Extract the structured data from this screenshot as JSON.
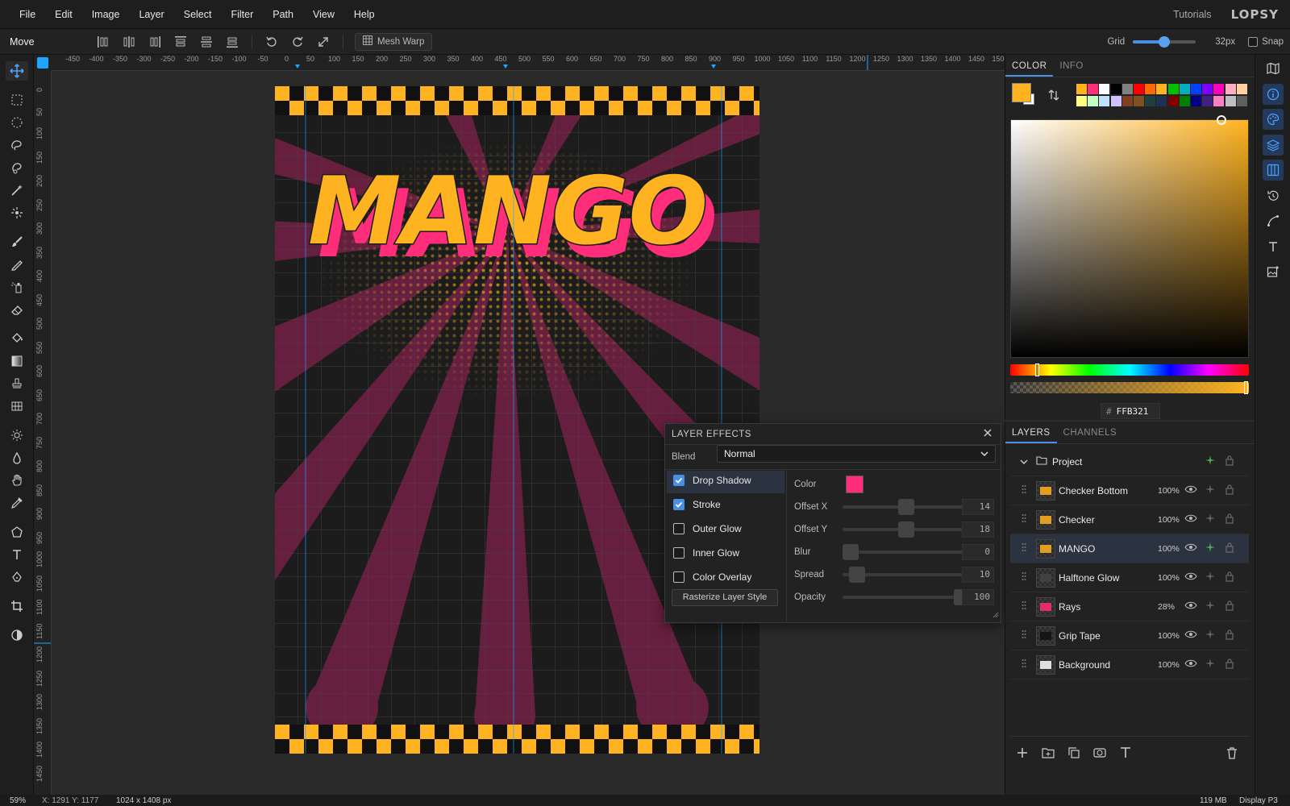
{
  "app": {
    "menu": [
      "File",
      "Edit",
      "Image",
      "Layer",
      "Select",
      "Filter",
      "Path",
      "View",
      "Help"
    ],
    "tutorials_label": "Tutorials",
    "logo_text": "LOPSY"
  },
  "options_bar": {
    "tool_name": "Move",
    "mesh_warp_label": "Mesh Warp",
    "grid_label": "Grid",
    "grid_size": "32px",
    "grid_slider_fraction": 0.5,
    "snap_label": "Snap"
  },
  "rulers": {
    "top_ticks": [
      "-450",
      "-400",
      "-350",
      "-300",
      "-250",
      "-200",
      "-150",
      "-100",
      "-50",
      "0",
      "50",
      "100",
      "150",
      "200",
      "250",
      "300",
      "350",
      "400",
      "450",
      "500",
      "550",
      "600",
      "650",
      "700",
      "750",
      "800",
      "850",
      "900",
      "950",
      "1000",
      "1050",
      "1100",
      "1150",
      "1200",
      "1250",
      "1300",
      "1350",
      "1400",
      "1450",
      "1500"
    ],
    "left_ticks": [
      "0",
      "50",
      "100",
      "150",
      "200",
      "250",
      "300",
      "350",
      "400",
      "450",
      "500",
      "550",
      "600",
      "650",
      "700",
      "750",
      "800",
      "850",
      "900",
      "950",
      "1000",
      "1050",
      "1100",
      "1150",
      "1200",
      "1250",
      "1300",
      "1350",
      "1400",
      "1450"
    ]
  },
  "canvas": {
    "title_text": "MANGO",
    "accent_orange": "#FFB321",
    "accent_pink": "#FF2D7A",
    "ray_color": "#6B2040",
    "bg_color": "#1c1c1c"
  },
  "color_panel": {
    "tabs": [
      "COLOR",
      "INFO"
    ],
    "hex_prefix": "#",
    "hex_value": "FFB321",
    "primary": "#FFB321",
    "secondary": "#FFFFFF",
    "swatches_row1": [
      "#FFB321",
      "#FF2D7A",
      "#FFFFFF",
      "#000000",
      "#808080",
      "#FF0000",
      "#FF6A00",
      "#FFB321",
      "#00C000",
      "#00B0C0",
      "#0040FF",
      "#8000FF",
      "#FF00C0",
      "#FFB0C0",
      "#FFD0A0"
    ],
    "swatches_row2": [
      "#FFFF80",
      "#C0FFC0",
      "#C0E0FF",
      "#D0C0FF",
      "#804020",
      "#805020",
      "#204040",
      "#203050",
      "#800000",
      "#008000",
      "#000080",
      "#402080",
      "#FF80C0",
      "#C0C0C0",
      "#606060"
    ]
  },
  "layers_panel": {
    "tabs": [
      "LAYERS",
      "CHANNELS"
    ],
    "group_name": "Project",
    "layers": [
      {
        "name": "Checker Bottom",
        "opacity": "100%"
      },
      {
        "name": "Checker",
        "opacity": "100%"
      },
      {
        "name": "MANGO",
        "opacity": "100%"
      },
      {
        "name": "Halftone Glow",
        "opacity": "100%"
      },
      {
        "name": "Rays",
        "opacity": "28%"
      },
      {
        "name": "Grip Tape",
        "opacity": "100%"
      },
      {
        "name": "Background",
        "opacity": "100%"
      }
    ]
  },
  "layer_effects": {
    "title": "LAYER EFFECTS",
    "blend_label": "Blend",
    "blend_value": "Normal",
    "effects": [
      {
        "name": "Drop Shadow",
        "checked": true
      },
      {
        "name": "Stroke",
        "checked": true
      },
      {
        "name": "Outer Glow",
        "checked": false
      },
      {
        "name": "Inner Glow",
        "checked": false
      },
      {
        "name": "Color Overlay",
        "checked": false
      }
    ],
    "rasterize_label": "Rasterize Layer Style",
    "color_label": "Color",
    "shadow_color": "#FF2D7A",
    "params": [
      {
        "label": "Offset X",
        "value": "14",
        "fraction": 0.5
      },
      {
        "label": "Offset Y",
        "value": "18",
        "fraction": 0.5
      },
      {
        "label": "Blur",
        "value": "0",
        "fraction": 0.0
      },
      {
        "label": "Spread",
        "value": "10",
        "fraction": 0.06
      },
      {
        "label": "Opacity",
        "value": "100",
        "fraction": 1.0
      }
    ]
  },
  "status": {
    "zoom": "59%",
    "coords": "X: 1291 Y: 1177",
    "doc_size": "1024 x 1408 px",
    "memory": "119 MB",
    "display": "Display P3"
  }
}
